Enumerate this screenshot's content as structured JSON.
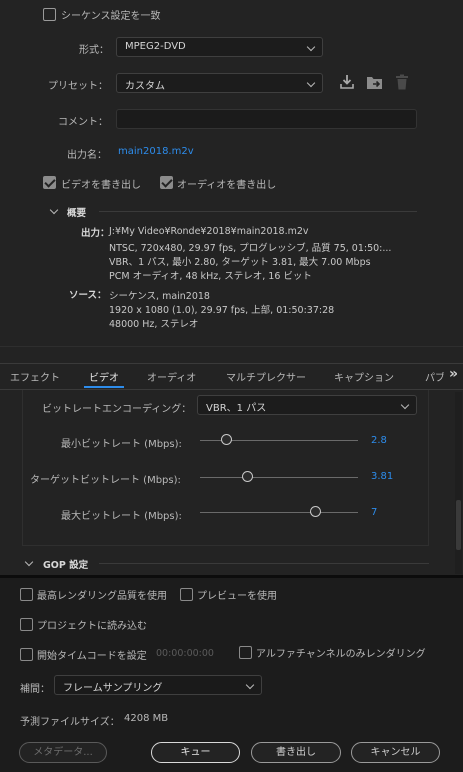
{
  "top": {
    "match_sequence_label": "シーケンス設定を一致",
    "format_label": "形式：",
    "format_value": "MPEG2-DVD",
    "preset_label": "プリセット：",
    "preset_value": "カスタム",
    "comment_label": "コメント：",
    "comment_value": "",
    "output_name_label": "出力名：",
    "output_name_value": "main2018.m2v",
    "export_video_label": "ビデオを書き出し",
    "export_audio_label": "オーディオを書き出し"
  },
  "summary": {
    "title": "概要",
    "output_label": "出力：",
    "output_lines": [
      "J:¥My Video¥Ronde¥2018¥main2018.m2v",
      "NTSC, 720x480, 29.97 fps, プログレッシブ, 品質 75, 01:50:...",
      "VBR、1 パス, 最小 2.80, ターゲット 3.81, 最大 7.00 Mbps",
      "PCM オーディオ, 48 kHz, ステレオ, 16 ビット"
    ],
    "source_label": "ソース：",
    "source_lines": [
      "シーケンス, main2018",
      "1920 x 1080 (1.0), 29.97 fps, 上部, 01:50:37:28",
      "48000 Hz, ステレオ"
    ]
  },
  "tabs": [
    "エフェクト",
    "ビデオ",
    "オーディオ",
    "マルチプレクサー",
    "キャプション",
    "パブ"
  ],
  "tabs_more": "»",
  "video": {
    "bitrate_encoding_label": "ビットレートエンコーディング：",
    "bitrate_encoding_value": "VBR、1 パス",
    "min_bitrate_label": "最小ビットレート (Mbps):",
    "min_bitrate_value": "2.8",
    "min_bitrate_fraction": 0.17,
    "target_bitrate_label": "ターゲットビットレート (Mbps):",
    "target_bitrate_value": "3.81",
    "target_bitrate_fraction": 0.3,
    "max_bitrate_label": "最大ビットレート (Mbps):",
    "max_bitrate_value": "7",
    "max_bitrate_fraction": 0.73,
    "gop_label": "GOP 設定"
  },
  "bottom": {
    "max_render_quality_label": "最高レンダリング品質を使用",
    "use_preview_label": "プレビューを使用",
    "import_project_label": "プロジェクトに読み込む",
    "start_timecode_label": "開始タイムコードを設定",
    "start_timecode_value": "00:00:00:00",
    "alpha_only_label": "アルファチャンネルのみレンダリング",
    "interpolation_label": "補間：",
    "interpolation_value": "フレームサンプリング",
    "file_size_label": "予測ファイルサイズ：",
    "file_size_value": "4208 MB",
    "metadata_button": "メタデータ...",
    "queue_button": "キュー",
    "export_button": "書き出し",
    "cancel_button": "キャンセル"
  },
  "colors": {
    "accent": "#2d8ceb",
    "background": "#232323"
  }
}
